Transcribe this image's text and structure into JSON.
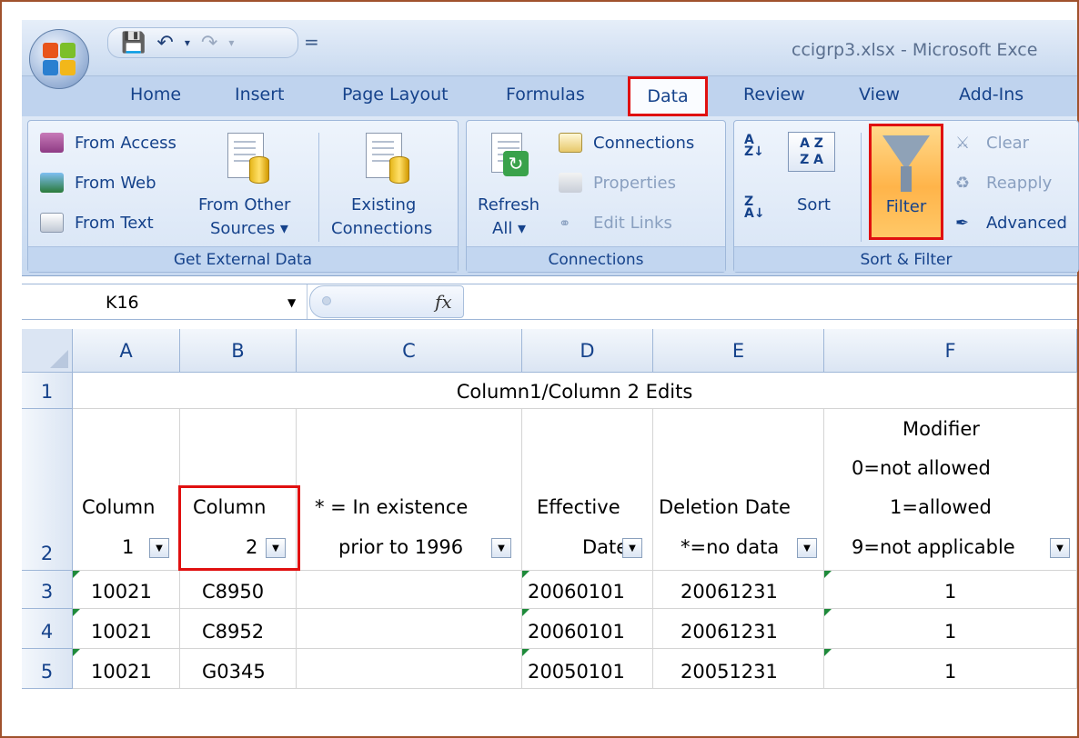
{
  "window": {
    "title": "ccigrp3.xlsx - Microsoft Exce"
  },
  "qat": {
    "save_icon": "save-icon",
    "undo_icon": "undo-icon",
    "redo_icon": "redo-icon",
    "more": "="
  },
  "tabs": [
    "Home",
    "Insert",
    "Page Layout",
    "Formulas",
    "Data",
    "Review",
    "View",
    "Add-Ins"
  ],
  "ribbon": {
    "get_external": {
      "from_access": "From Access",
      "from_web": "From Web",
      "from_text": "From Text",
      "from_other_1": "From Other",
      "from_other_2": "Sources ▾",
      "existing_1": "Existing",
      "existing_2": "Connections",
      "label": "Get External Data"
    },
    "connections": {
      "refresh_1": "Refresh",
      "refresh_2": "All ▾",
      "connections": "Connections",
      "properties": "Properties",
      "edit_links": "Edit Links",
      "label": "Connections"
    },
    "sort_filter": {
      "sort": "Sort",
      "filter": "Filter",
      "clear": "Clear",
      "reapply": "Reapply",
      "advanced": "Advanced",
      "label": "Sort & Filter"
    }
  },
  "formula_bar": {
    "name_box": "K16",
    "fx": "fx",
    "value": ""
  },
  "columns": [
    "A",
    "B",
    "C",
    "D",
    "E",
    "F"
  ],
  "rows": [
    "1",
    "2",
    "3",
    "4",
    "5"
  ],
  "sheet": {
    "title": "Column1/Column 2 Edits",
    "headers": {
      "a": [
        "Column",
        "1"
      ],
      "b": [
        "Column",
        "2"
      ],
      "c": [
        "* = In existence",
        "prior to 1996"
      ],
      "d": [
        "Effective",
        "Date"
      ],
      "e": [
        "Deletion Date",
        "*=no data"
      ],
      "f": [
        "Modifier",
        "0=not allowed",
        "1=allowed",
        "9=not applicable"
      ]
    },
    "data": [
      [
        "10021",
        "C8950",
        "",
        "20060101",
        "20061231",
        "1"
      ],
      [
        "10021",
        "C8952",
        "",
        "20060101",
        "20061231",
        "1"
      ],
      [
        "10021",
        "G0345",
        "",
        "20050101",
        "20051231",
        "1"
      ]
    ]
  }
}
